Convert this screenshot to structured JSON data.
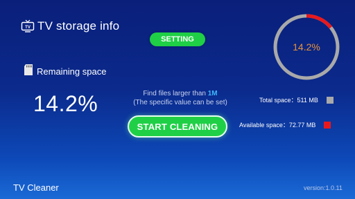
{
  "header": {
    "title": "TV storage info",
    "tv_icon_text": "TV"
  },
  "setting_button": {
    "label": "SETTING"
  },
  "remaining": {
    "label": "Remaining space",
    "percent_text": "14.2%"
  },
  "hint": {
    "line1_prefix": "Find files larger than ",
    "line1_value": "1M",
    "line2": "(The specific value can be set)"
  },
  "start_button": {
    "label": "START CLEANING"
  },
  "ring": {
    "center_text": "14.2%",
    "used_fraction": 0.142,
    "track_color": "#a9a9a9",
    "used_color": "#e8191e"
  },
  "stats": {
    "total_label": "Total space：",
    "total_value": "511 MB",
    "total_color": "#a9a9a9",
    "available_label": "Available space：",
    "available_value": "72.77 MB",
    "available_color": "#e8191e"
  },
  "footer": {
    "app_name": "TV Cleaner",
    "version": "version:1.0.11"
  }
}
